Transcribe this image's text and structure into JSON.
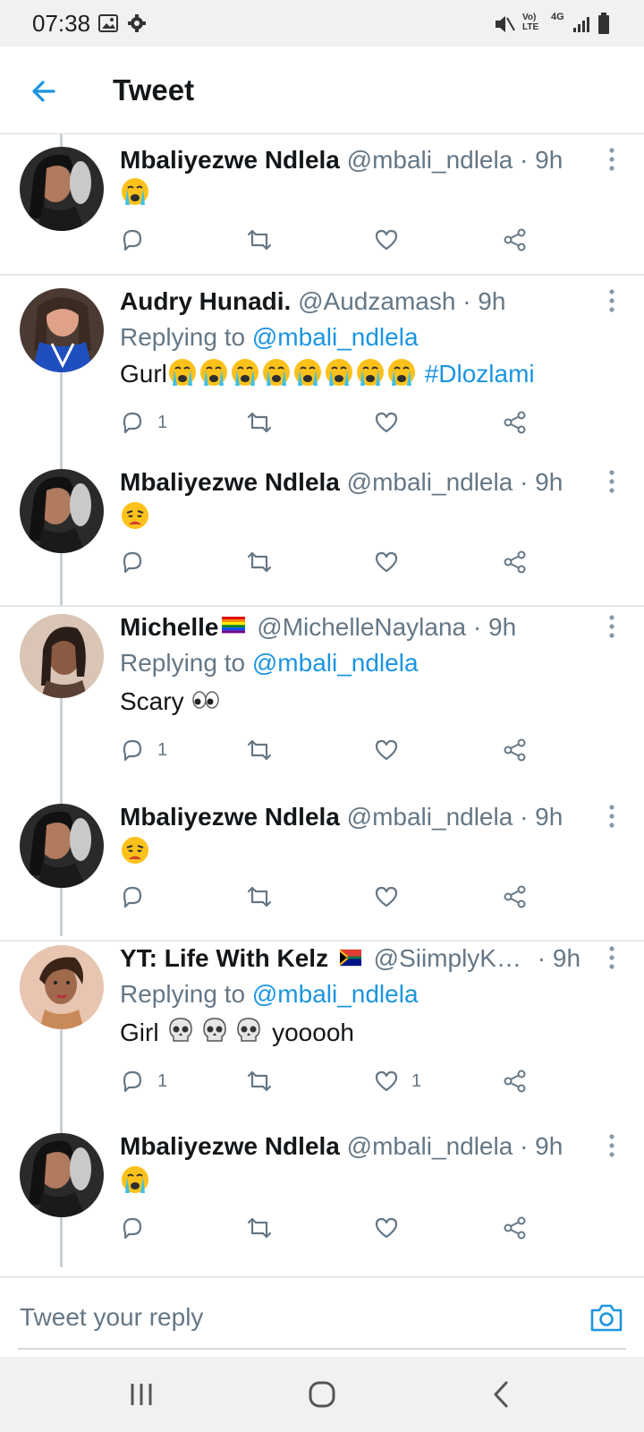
{
  "status_bar": {
    "time": "07:38",
    "network": "4G"
  },
  "header": {
    "title": "Tweet"
  },
  "tweets": [
    {
      "name": "Mbaliyezwe Ndlela",
      "handle": "@mbali_ndlela · 9h",
      "emoji": "loudly-crying-face",
      "reply_count": "",
      "like_count": ""
    },
    {
      "name": "Audry Hunadi.",
      "handle": "@Audzamash · 9h",
      "replying_prefix": "Replying to ",
      "replying_to": "@mbali_ndlela",
      "text": "Gurl",
      "emojis": [
        "loudly-crying-face",
        "loudly-crying-face",
        "loudly-crying-face",
        "loudly-crying-face",
        "loudly-crying-face",
        "loudly-crying-face",
        "loudly-crying-face",
        "loudly-crying-face"
      ],
      "hashtag": "#Dlozlami",
      "reply_count": "1",
      "like_count": ""
    },
    {
      "name": "Mbaliyezwe Ndlela",
      "handle": "@mbali_ndlela · 9h",
      "emoji": "weary-face",
      "reply_count": "",
      "like_count": ""
    },
    {
      "name": "Michelle",
      "name_emoji": "rainbow-flag",
      "handle": "@MichelleNaylana · 9h",
      "replying_prefix": "Replying to ",
      "replying_to": "@mbali_ndlela",
      "text": "Scary ",
      "emojis": [
        "eyes"
      ],
      "reply_count": "1",
      "like_count": ""
    },
    {
      "name": "Mbaliyezwe Ndlela",
      "handle": "@mbali_ndlela · 9h",
      "emoji": "weary-face",
      "reply_count": "",
      "like_count": ""
    },
    {
      "name": "YT: Life With Kelz ",
      "name_emoji": "south-africa-flag",
      "handle": "@SiimplyK…",
      "time": "· 9h",
      "replying_prefix": "Replying to ",
      "replying_to": "@mbali_ndlela",
      "text": "Girl ",
      "emojis": [
        "skull",
        "skull",
        "skull"
      ],
      "text_after": " yooooh",
      "reply_count": "1",
      "like_count": "1"
    },
    {
      "name": "Mbaliyezwe Ndlela",
      "handle": "@mbali_ndlela · 9h",
      "emoji": "loudly-crying-face",
      "reply_count": "",
      "like_count": ""
    }
  ],
  "reply_bar": {
    "placeholder": "Tweet your reply"
  },
  "colors": {
    "accent": "#1b95e0",
    "text": "#14171a",
    "muted": "#657786",
    "divider": "#e4e7ea"
  }
}
